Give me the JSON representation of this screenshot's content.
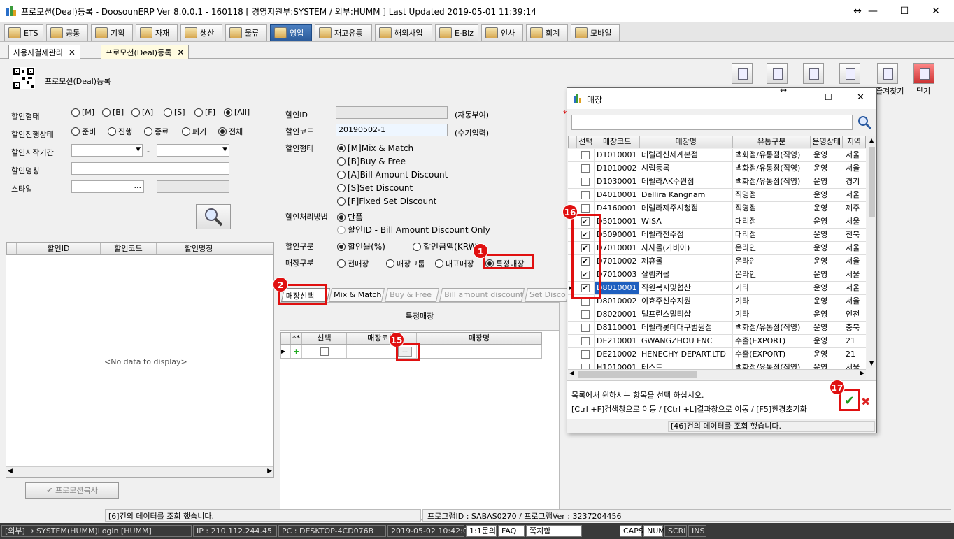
{
  "window": {
    "title": "프로모션(Deal)등록 - DoosounERP Ver 8.0.0.1 - 160118 [ 경영지원부:SYSTEM / 외부:HUMM ]    Last Updated 2019-05-01 11:39:14",
    "resize_glyph": "↔",
    "minimize": "—",
    "maximize": "☐",
    "close": "✕"
  },
  "menu": [
    {
      "label": "ETS",
      "icon": "ets-icon"
    },
    {
      "label": "공통",
      "icon": "common-icon"
    },
    {
      "label": "기획",
      "icon": "plan-icon"
    },
    {
      "label": "자재",
      "icon": "material-icon"
    },
    {
      "label": "생산",
      "icon": "production-icon"
    },
    {
      "label": "물류",
      "icon": "logistics-icon"
    },
    {
      "label": "영업",
      "icon": "sales-icon"
    },
    {
      "label": "재고유통",
      "icon": "inventory-icon"
    },
    {
      "label": "해외사업",
      "icon": "overseas-icon"
    },
    {
      "label": "E-Biz",
      "icon": "ebiz-icon"
    },
    {
      "label": "인사",
      "icon": "hr-icon"
    },
    {
      "label": "회계",
      "icon": "accounting-icon"
    },
    {
      "label": "모바일",
      "icon": "mobile-icon"
    }
  ],
  "doc_tabs": [
    {
      "label": "사용자결제관리",
      "close": "✕"
    },
    {
      "label": "프로모션(Deal)등록",
      "close": "✕"
    }
  ],
  "page": {
    "title": "프로모션(Deal)등록"
  },
  "toolbar": {
    "labels": [
      "",
      "",
      "",
      "",
      "즐겨찾기",
      "닫기"
    ]
  },
  "search": {
    "type_label": "할인형태",
    "type_options": [
      "[M]",
      "[B]",
      "[A]",
      "[S]",
      "[F]",
      "[All]"
    ],
    "type_selected": 5,
    "status_label": "할인진행상태",
    "status_options": [
      "준비",
      "진행",
      "종료",
      "폐기",
      "전체"
    ],
    "status_selected": 4,
    "period_label": "할인시작기간",
    "period_sep": "-",
    "name_label": "할인명칭",
    "style_label": "스타일",
    "ellipsis": "..."
  },
  "left_grid": {
    "headers": [
      "할인ID",
      "할인코드",
      "할인명칭"
    ],
    "empty": "<No data to display>",
    "copy_button": "프로모션복사"
  },
  "form": {
    "id_label": "할인ID",
    "id_value": "",
    "id_hint": "(자동부여)",
    "code_label": "할인코드",
    "code_value": "20190502-1",
    "code_hint": "(수기입력)",
    "type_label": "할인형태",
    "type_options": [
      "[M]Mix & Match",
      "[B]Buy & Free",
      "[A]Bill Amount Discount",
      "[S]Set Discount",
      "[F]Fixed Set Discount"
    ],
    "type_selected": 0,
    "method_label": "할인처리방법",
    "method_options": [
      "단품",
      "할인ID - Bill Amount Discount Only"
    ],
    "method_selected": 0,
    "kind_label": "할인구분",
    "kind_options": [
      "할인율(%)",
      "할인금액(KRW)"
    ],
    "kind_selected": 0,
    "store_label": "매장구분",
    "store_options": [
      "전매장",
      "매장그룹",
      "대표매장",
      "특정매장"
    ],
    "store_selected": 3
  },
  "tabs": [
    "매장선택",
    "Mix & Match",
    "Buy & Free",
    "Bill amount discount",
    "Set Disco"
  ],
  "store_grid": {
    "section_title": "특정매장",
    "headers": [
      "**",
      "선택",
      "매장코드",
      "매장명"
    ],
    "row_marker": "▶",
    "add_glyph": "+"
  },
  "dialog": {
    "title": "매장",
    "headers": [
      "선택",
      "매장코드",
      "매장명",
      "유통구분",
      "운영상태",
      "지역"
    ],
    "rows": [
      {
        "checked": false,
        "code": "D1010001",
        "name": "데렐라신세계본점",
        "dist": "백화점/유통점(직영)",
        "state": "운영",
        "region": "서울"
      },
      {
        "checked": false,
        "code": "D1010002",
        "name": "시럽등록",
        "dist": "백화점/유통점(직영)",
        "state": "운영",
        "region": "서울"
      },
      {
        "checked": false,
        "code": "D1030001",
        "name": "데렐라AK수원점",
        "dist": "백화점/유통점(직영)",
        "state": "운영",
        "region": "경기"
      },
      {
        "checked": false,
        "code": "D4010001",
        "name": "Dellira Kangnam",
        "dist": "직영점",
        "state": "운영",
        "region": "서울"
      },
      {
        "checked": false,
        "code": "D4160001",
        "name": "데렐라제주시청점",
        "dist": "직영점",
        "state": "운영",
        "region": "제주"
      },
      {
        "checked": true,
        "code": "D5010001",
        "name": "WISA",
        "dist": "대리점",
        "state": "운영",
        "region": "서울"
      },
      {
        "checked": true,
        "code": "D5090001",
        "name": "데렐라전주점",
        "dist": "대리점",
        "state": "운영",
        "region": "전북"
      },
      {
        "checked": true,
        "code": "D7010001",
        "name": "자사몰(가비아)",
        "dist": "온라인",
        "state": "운영",
        "region": "서울"
      },
      {
        "checked": true,
        "code": "D7010002",
        "name": "제휴몰",
        "dist": "온라인",
        "state": "운영",
        "region": "서울"
      },
      {
        "checked": true,
        "code": "D7010003",
        "name": "살림커몰",
        "dist": "온라인",
        "state": "운영",
        "region": "서울"
      },
      {
        "checked": true,
        "code": "D8010001",
        "name": "직원복지및협찬",
        "dist": "기타",
        "state": "운영",
        "region": "서울"
      },
      {
        "checked": false,
        "code": "D8010002",
        "name": "이효주선수지원",
        "dist": "기타",
        "state": "운영",
        "region": "서울"
      },
      {
        "checked": false,
        "code": "D8020001",
        "name": "델프린스멀티샵",
        "dist": "기타",
        "state": "운영",
        "region": "인천"
      },
      {
        "checked": false,
        "code": "D8110001",
        "name": "데렐라롯데대구범원점",
        "dist": "백화점/유통점(직영)",
        "state": "운영",
        "region": "충북"
      },
      {
        "checked": false,
        "code": "DE210001",
        "name": "GWANGZHOU FNC",
        "dist": "수출(EXPORT)",
        "state": "운영",
        "region": "21"
      },
      {
        "checked": false,
        "code": "DE210002",
        "name": "HENECHY DEPART.LTD",
        "dist": "수출(EXPORT)",
        "state": "운영",
        "region": "21"
      },
      {
        "checked": false,
        "code": "H1010001",
        "name": "테스트",
        "dist": "백화점/유통점(직영)",
        "state": "운영",
        "region": "서울"
      }
    ],
    "hint1": "목록에서 원하시는 항목을 선택 하십시오.",
    "hint2": "[Ctrl +F]검색창으로 이동 / [Ctrl +L]결과창으로 이동 / [F5]환경초기화",
    "ok": "✔",
    "cancel": "✖",
    "footer": "[46]건의 데이터를 조회 했습니다."
  },
  "annotations": [
    "1",
    "2",
    "15",
    "16",
    "17"
  ],
  "status": {
    "left_msg": "[6]건의 데이터를 조회 했습니다.",
    "program": "프로그램ID : SABAS0270 / 프로그램Ver : 3237204456"
  },
  "bottom": [
    "[외부]  → SYSTEM(HUMM)Login [HUMM]",
    "IP : 210.112.244.45",
    "PC : DESKTOP-4CD076B",
    "2019-05-02 10:42:02",
    "1:1문의",
    "FAQ",
    "쪽지함",
    "CAPS",
    "NUM",
    "SCRL",
    "INS"
  ],
  "colors": {
    "accent": "#2c5c9c",
    "annotation": "#e01010"
  }
}
